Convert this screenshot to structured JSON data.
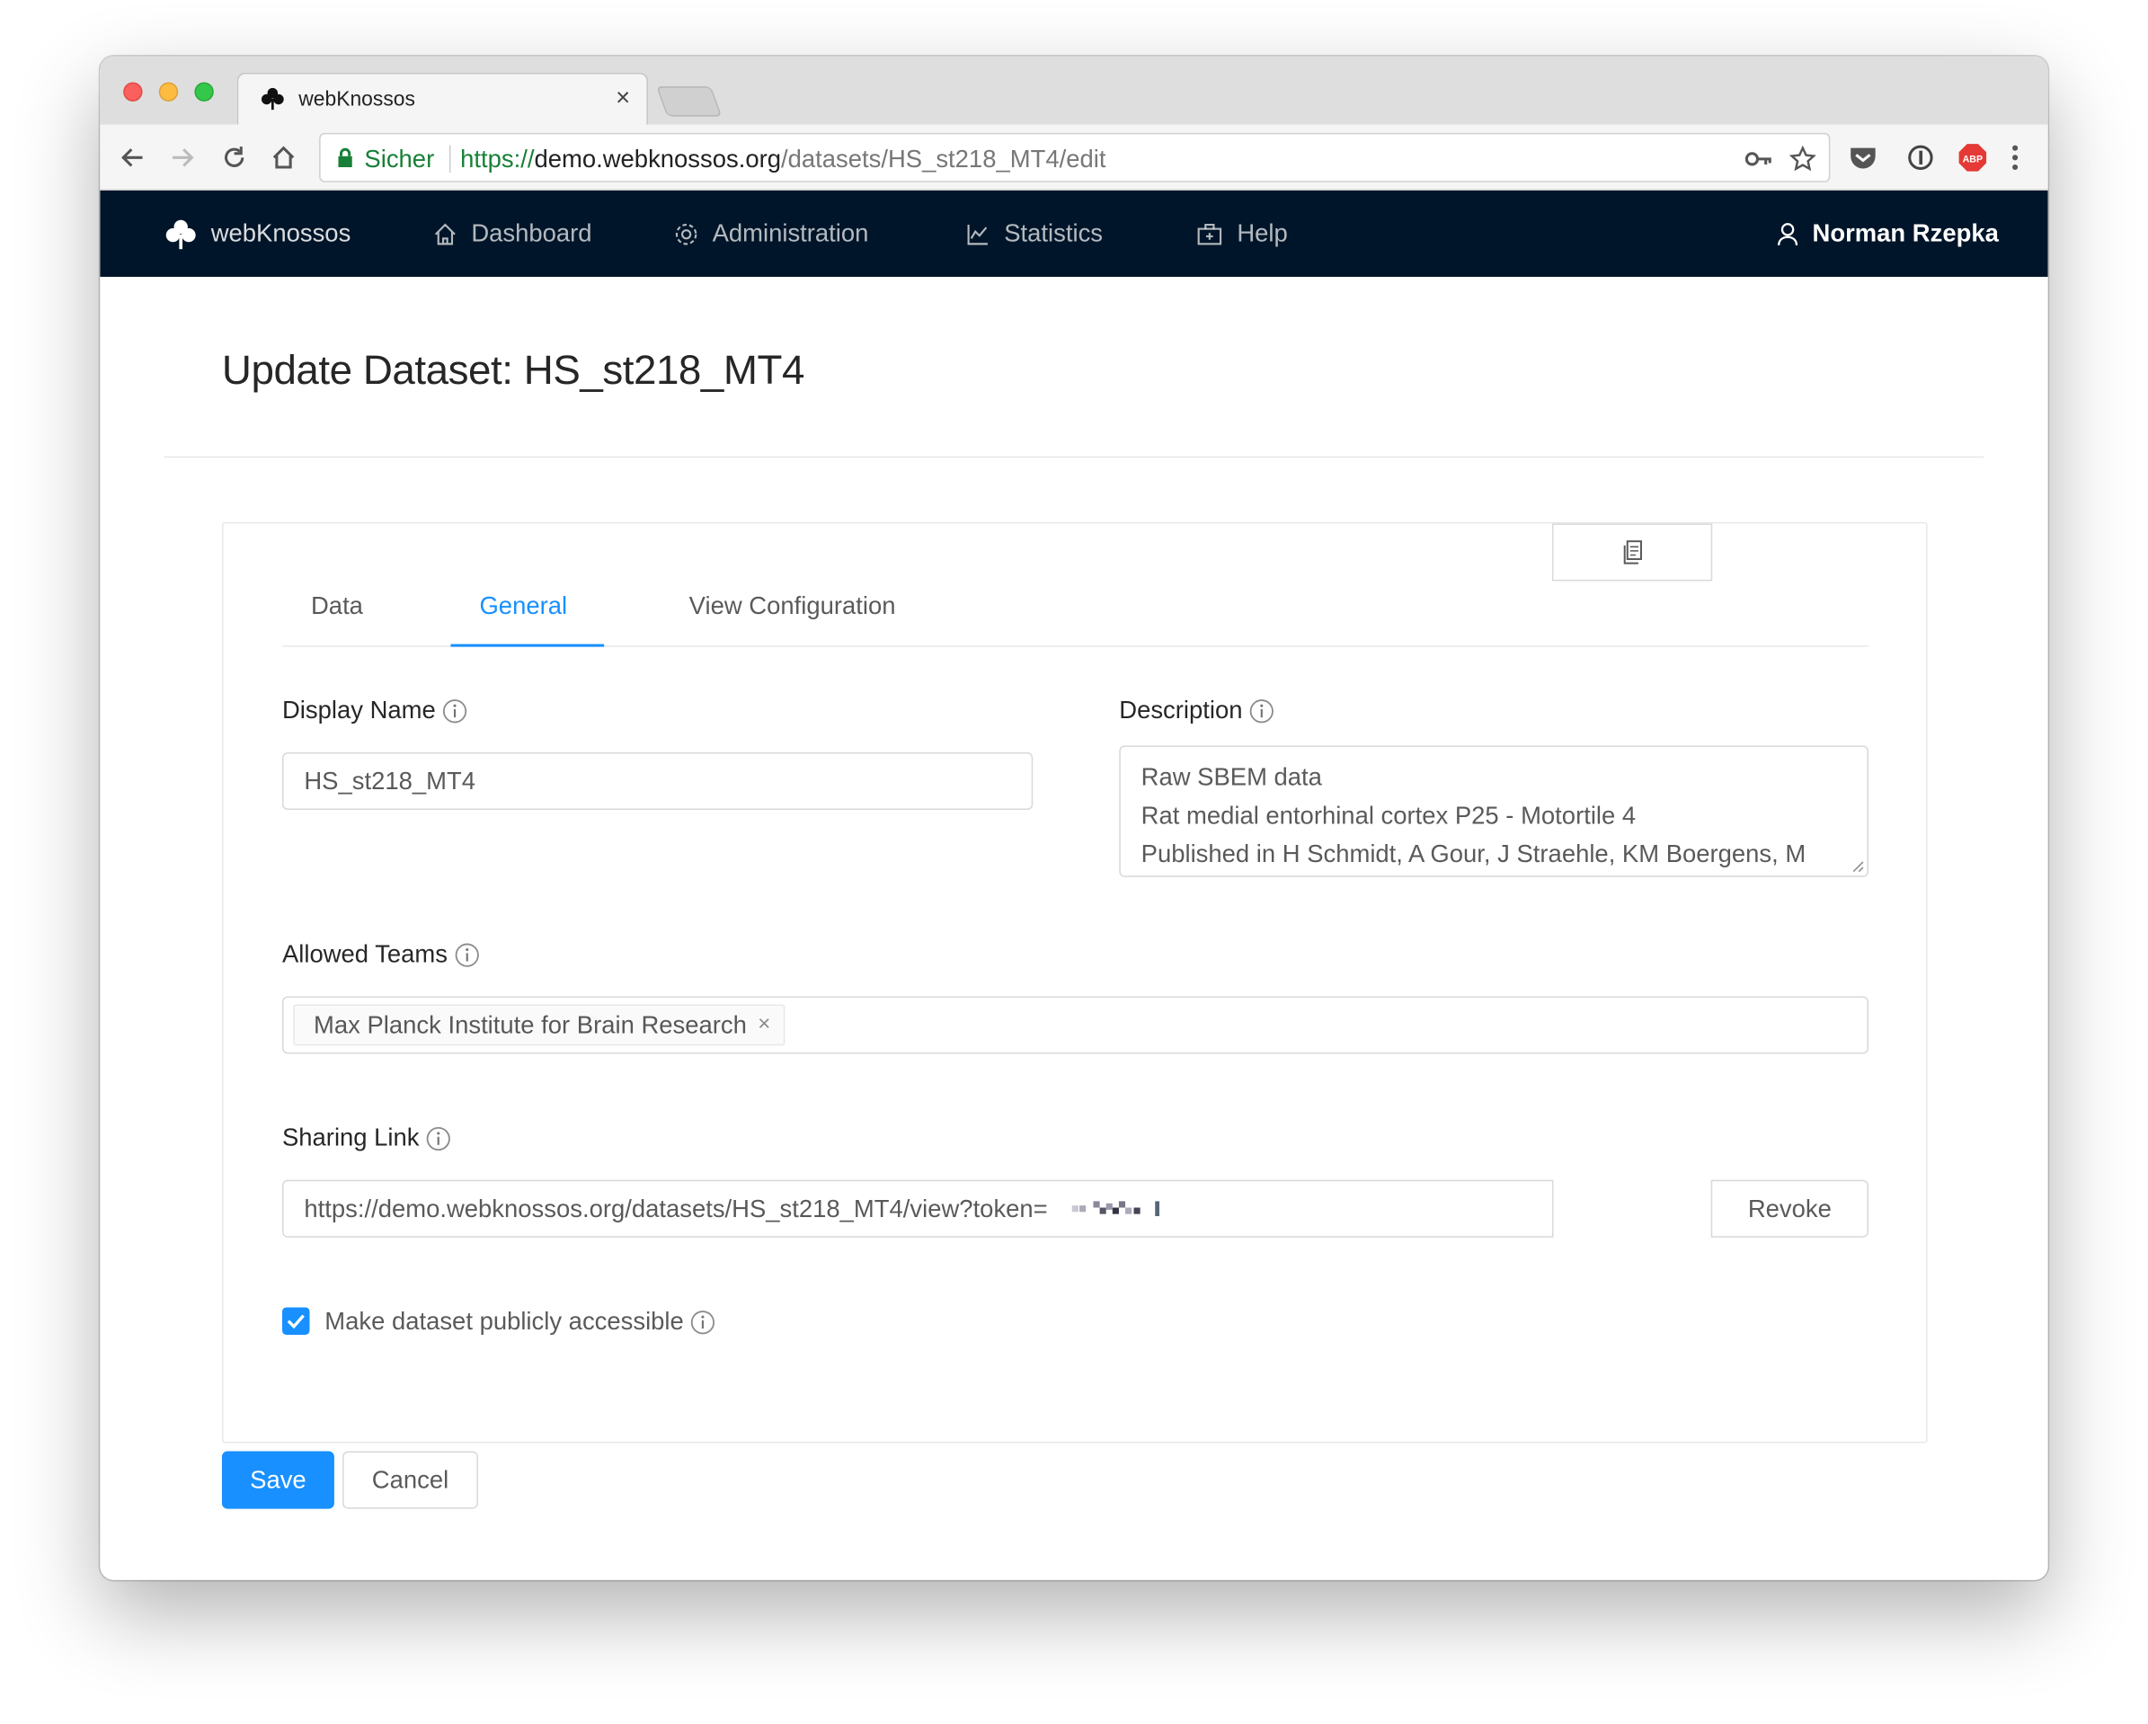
{
  "browser": {
    "tab_title": "webKnossos",
    "secure_label": "Sicher",
    "url_scheme": "https://",
    "url_host": "demo.webknossos.org",
    "url_path": "/datasets/HS_st218_MT4/edit"
  },
  "nav": {
    "brand": "webKnossos",
    "items": [
      {
        "label": "Dashboard",
        "icon": "home-icon"
      },
      {
        "label": "Administration",
        "icon": "gear-icon"
      },
      {
        "label": "Statistics",
        "icon": "line-chart-icon"
      },
      {
        "label": "Help",
        "icon": "medicine-box-icon"
      }
    ],
    "user": "Norman Rzepka"
  },
  "page": {
    "title": "Update Dataset: HS_st218_MT4",
    "tabs": [
      "Data",
      "General",
      "View Configuration"
    ],
    "active_tab": "General"
  },
  "form": {
    "display_name": {
      "label": "Display Name",
      "value": "HS_st218_MT4"
    },
    "description": {
      "label": "Description",
      "lines": [
        "Raw SBEM data",
        "Rat medial entorhinal cortex P25 - Motortile 4",
        "Published in H Schmidt, A Gour, J Straehle, KM Boergens, M"
      ]
    },
    "allowed_teams": {
      "label": "Allowed Teams",
      "tags": [
        "Max Planck Institute for Brain Research"
      ]
    },
    "sharing_link": {
      "label": "Sharing Link",
      "value": "https://demo.webknossos.org/datasets/HS_st218_MT4/view?token=",
      "revoke_label": "Revoke"
    },
    "public": {
      "label": "Make dataset publicly accessible",
      "checked": true
    }
  },
  "actions": {
    "save_label": "Save",
    "cancel_label": "Cancel"
  },
  "colors": {
    "primary": "#1890ff",
    "header": "#001529"
  }
}
